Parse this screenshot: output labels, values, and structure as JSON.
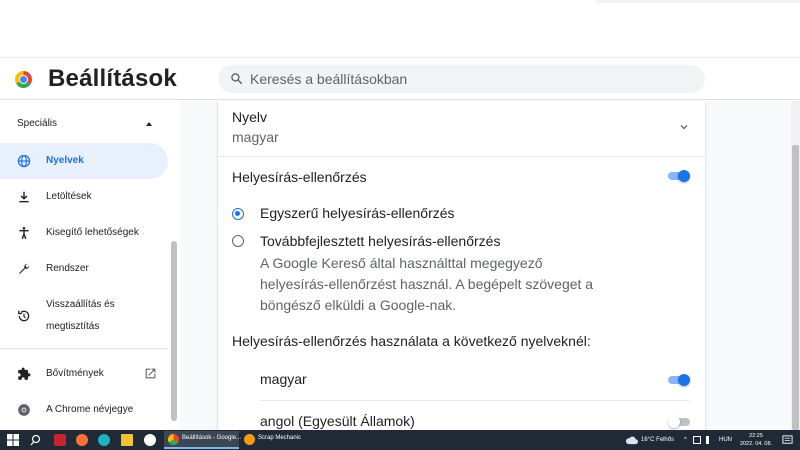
{
  "header": {
    "title": "Beállítások",
    "search_placeholder": "Keresés a beállításokban"
  },
  "sidebar": {
    "section_label": "Speciális",
    "items": [
      {
        "label": "Nyelvek",
        "icon": "globe-icon",
        "active": true
      },
      {
        "label": "Letöltések",
        "icon": "download-icon"
      },
      {
        "label": "Kisegítő lehetőségek",
        "icon": "accessibility-icon"
      },
      {
        "label": "Rendszer",
        "icon": "wrench-icon"
      },
      {
        "label_line1": "Visszaállítás és",
        "label_line2": "megtisztítás",
        "icon": "history-icon"
      },
      {
        "label": "Bővítmények",
        "icon": "puzzle-icon"
      },
      {
        "label": "A Chrome névjegye",
        "icon": "chrome-icon"
      }
    ]
  },
  "main": {
    "language": {
      "title": "Nyelv",
      "value": "magyar"
    },
    "spellcheck": {
      "title": "Helyesírás-ellenőrzés",
      "enabled": true,
      "basic_label": "Egyszerű helyesírás-ellenőrzés",
      "enhanced_label": "Továbbfejlesztett helyesírás-ellenőrzés",
      "enhanced_desc": "A Google Kereső által használttal megegyező helyesírás-ellenőrzést használ. A begépelt szöveget a böngésző elküldi a Google-nak.",
      "languages_heading": "Helyesírás-ellenőrzés használata a következő nyelveknél:",
      "languages": [
        {
          "name": "magyar",
          "enabled": true
        },
        {
          "name": "angol (Egyesült Államok)",
          "enabled": false
        }
      ]
    }
  },
  "taskbar": {
    "tasks": [
      {
        "label": "Beállítások - Google...",
        "active": true
      },
      {
        "label": "Scrap Mechanic",
        "active": false
      }
    ],
    "weather": "16°C  Felhős",
    "language": "HUN",
    "time": "22:25",
    "date": "2022. 04. 08."
  },
  "colors": {
    "accent": "#1a73e8",
    "active_bg": "#e8f0fe",
    "taskbar": "#1f2a36"
  }
}
